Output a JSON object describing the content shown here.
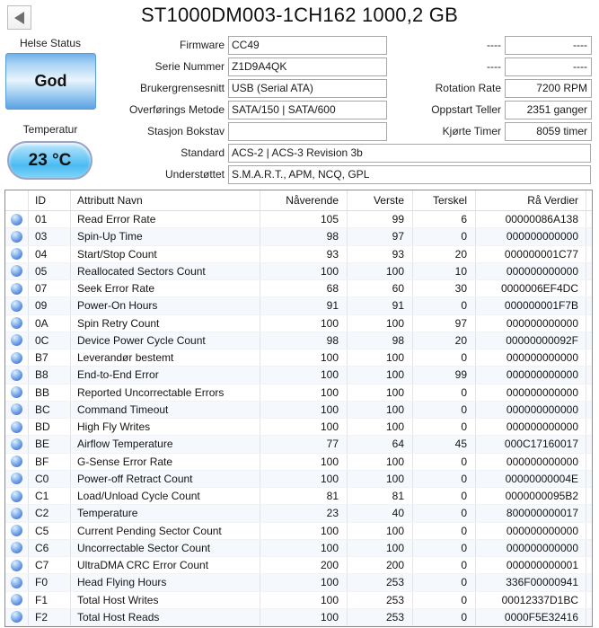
{
  "window": {
    "title": "ST1000DM003-1CH162 1000,2 GB"
  },
  "colors": {
    "health_good_blue": "#5ba2e2",
    "temperature_blue": "#4cbbf2",
    "orb_blue": "#5f8fe0"
  },
  "health": {
    "label": "Helse Status",
    "status": "God"
  },
  "temperature": {
    "label": "Temperatur",
    "value": "23 °C"
  },
  "info_left": [
    {
      "label": "Firmware",
      "value": "CC49",
      "wide": false
    },
    {
      "label": "Serie Nummer",
      "value": "Z1D9A4QK",
      "wide": false
    },
    {
      "label": "Brukergrensesnitt",
      "value": "USB (Serial ATA)",
      "wide": false
    },
    {
      "label": "Overførings Metode",
      "value": "SATA/150 | SATA/600",
      "wide": false
    },
    {
      "label": "Stasjon Bokstav",
      "value": "",
      "wide": false
    },
    {
      "label": "Standard",
      "value": "ACS-2 | ACS-3 Revision 3b",
      "wide": true
    },
    {
      "label": "Understøttet",
      "value": "S.M.A.R.T., APM, NCQ, GPL",
      "wide": true
    }
  ],
  "info_right": [
    {
      "label": "----",
      "value": "----"
    },
    {
      "label": "----",
      "value": "----"
    },
    {
      "label": "Rotation Rate",
      "value": "7200 RPM"
    },
    {
      "label": "Oppstart Teller",
      "value": "2351 ganger"
    },
    {
      "label": "Kjørte Timer",
      "value": "8059 timer"
    }
  ],
  "table": {
    "headers": {
      "id": "ID",
      "name": "Attributt Navn",
      "current": "Nåverende",
      "worst": "Verste",
      "threshold": "Terskel",
      "raw": "Rå Verdier"
    },
    "rows": [
      {
        "id": "01",
        "name": "Read Error Rate",
        "current": "105",
        "worst": "99",
        "threshold": "6",
        "raw": "00000086A138"
      },
      {
        "id": "03",
        "name": "Spin-Up Time",
        "current": "98",
        "worst": "97",
        "threshold": "0",
        "raw": "000000000000"
      },
      {
        "id": "04",
        "name": "Start/Stop Count",
        "current": "93",
        "worst": "93",
        "threshold": "20",
        "raw": "000000001C77"
      },
      {
        "id": "05",
        "name": "Reallocated Sectors Count",
        "current": "100",
        "worst": "100",
        "threshold": "10",
        "raw": "000000000000"
      },
      {
        "id": "07",
        "name": "Seek Error Rate",
        "current": "68",
        "worst": "60",
        "threshold": "30",
        "raw": "0000006EF4DC"
      },
      {
        "id": "09",
        "name": "Power-On Hours",
        "current": "91",
        "worst": "91",
        "threshold": "0",
        "raw": "000000001F7B"
      },
      {
        "id": "0A",
        "name": "Spin Retry Count",
        "current": "100",
        "worst": "100",
        "threshold": "97",
        "raw": "000000000000"
      },
      {
        "id": "0C",
        "name": "Device Power Cycle Count",
        "current": "98",
        "worst": "98",
        "threshold": "20",
        "raw": "00000000092F"
      },
      {
        "id": "B7",
        "name": "Leverandør bestemt",
        "current": "100",
        "worst": "100",
        "threshold": "0",
        "raw": "000000000000"
      },
      {
        "id": "B8",
        "name": "End-to-End Error",
        "current": "100",
        "worst": "100",
        "threshold": "99",
        "raw": "000000000000"
      },
      {
        "id": "BB",
        "name": "Reported Uncorrectable Errors",
        "current": "100",
        "worst": "100",
        "threshold": "0",
        "raw": "000000000000"
      },
      {
        "id": "BC",
        "name": "Command Timeout",
        "current": "100",
        "worst": "100",
        "threshold": "0",
        "raw": "000000000000"
      },
      {
        "id": "BD",
        "name": "High Fly Writes",
        "current": "100",
        "worst": "100",
        "threshold": "0",
        "raw": "000000000000"
      },
      {
        "id": "BE",
        "name": "Airflow Temperature",
        "current": "77",
        "worst": "64",
        "threshold": "45",
        "raw": "000C17160017"
      },
      {
        "id": "BF",
        "name": "G-Sense Error Rate",
        "current": "100",
        "worst": "100",
        "threshold": "0",
        "raw": "000000000000"
      },
      {
        "id": "C0",
        "name": "Power-off Retract Count",
        "current": "100",
        "worst": "100",
        "threshold": "0",
        "raw": "00000000004E"
      },
      {
        "id": "C1",
        "name": "Load/Unload Cycle Count",
        "current": "81",
        "worst": "81",
        "threshold": "0",
        "raw": "0000000095B2"
      },
      {
        "id": "C2",
        "name": "Temperature",
        "current": "23",
        "worst": "40",
        "threshold": "0",
        "raw": "800000000017"
      },
      {
        "id": "C5",
        "name": "Current Pending Sector Count",
        "current": "100",
        "worst": "100",
        "threshold": "0",
        "raw": "000000000000"
      },
      {
        "id": "C6",
        "name": "Uncorrectable Sector Count",
        "current": "100",
        "worst": "100",
        "threshold": "0",
        "raw": "000000000000"
      },
      {
        "id": "C7",
        "name": "UltraDMA CRC Error Count",
        "current": "200",
        "worst": "200",
        "threshold": "0",
        "raw": "000000000001"
      },
      {
        "id": "F0",
        "name": "Head Flying Hours",
        "current": "100",
        "worst": "253",
        "threshold": "0",
        "raw": "336F00000941"
      },
      {
        "id": "F1",
        "name": "Total Host Writes",
        "current": "100",
        "worst": "253",
        "threshold": "0",
        "raw": "00012337D1BC"
      },
      {
        "id": "F2",
        "name": "Total Host Reads",
        "current": "100",
        "worst": "253",
        "threshold": "0",
        "raw": "0000F5E32416"
      }
    ]
  }
}
